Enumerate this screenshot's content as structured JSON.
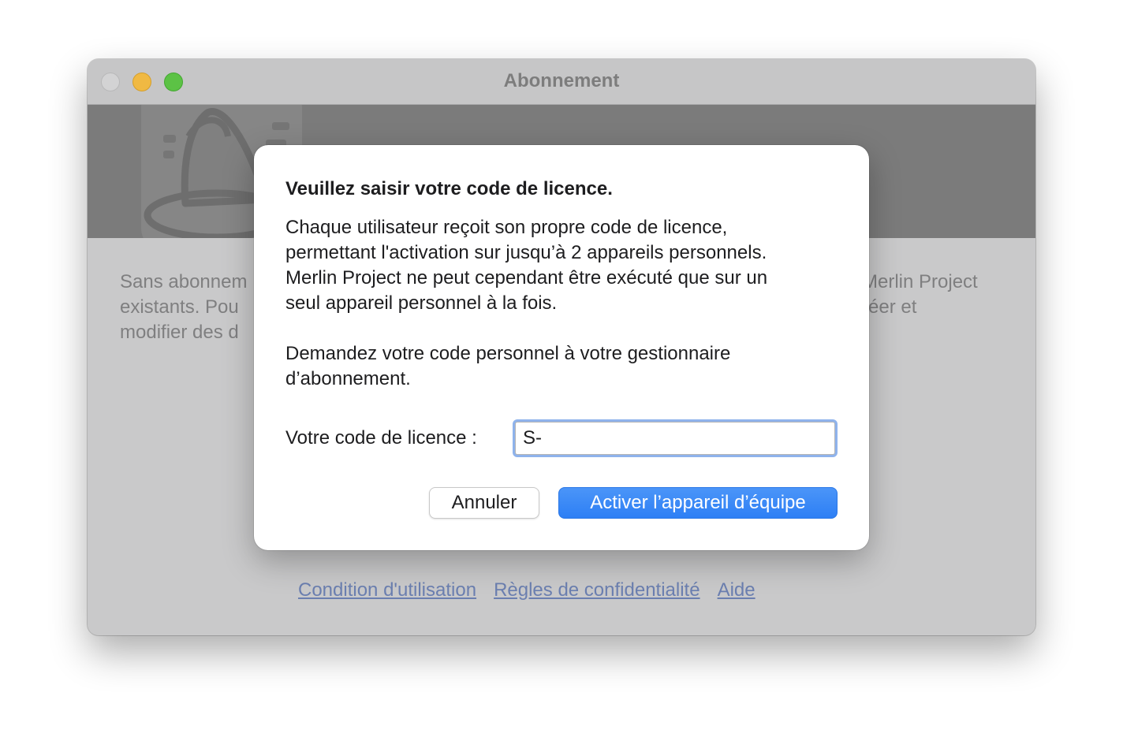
{
  "window": {
    "title": "Abonnement"
  },
  "background": {
    "left_lines": [
      "Sans abonnem",
      "existants. Pou",
      "modifier des d"
    ],
    "right_lines": [
      "Merlin Project",
      "réer et"
    ],
    "footer_links": [
      "Condition d'utilisation",
      "Règles de confidentialité",
      "Aide"
    ]
  },
  "dialog": {
    "title": "Veuillez saisir votre code de licence.",
    "paragraph1": [
      "Chaque utilisateur reçoit son propre code de licence,",
      "permettant l'activation sur jusqu’à 2 appareils personnels.",
      "Merlin Project ne peut cependant être exécuté que sur un",
      "seul appareil personnel à la fois."
    ],
    "paragraph2": [
      "Demandez votre code personnel à votre gestionnaire",
      "d’abonnement."
    ],
    "field_label": "Votre code de licence :",
    "field_value": "S-",
    "cancel_label": "Annuler",
    "primary_label": "Activer l’appareil d’équipe"
  },
  "colors": {
    "accent": "#2d7ff5",
    "focus_ring": "#8fb3ec",
    "link": "#6b7fb0"
  },
  "icons": {
    "banner_logo": "merlin-project-wizard-hat-icon"
  }
}
